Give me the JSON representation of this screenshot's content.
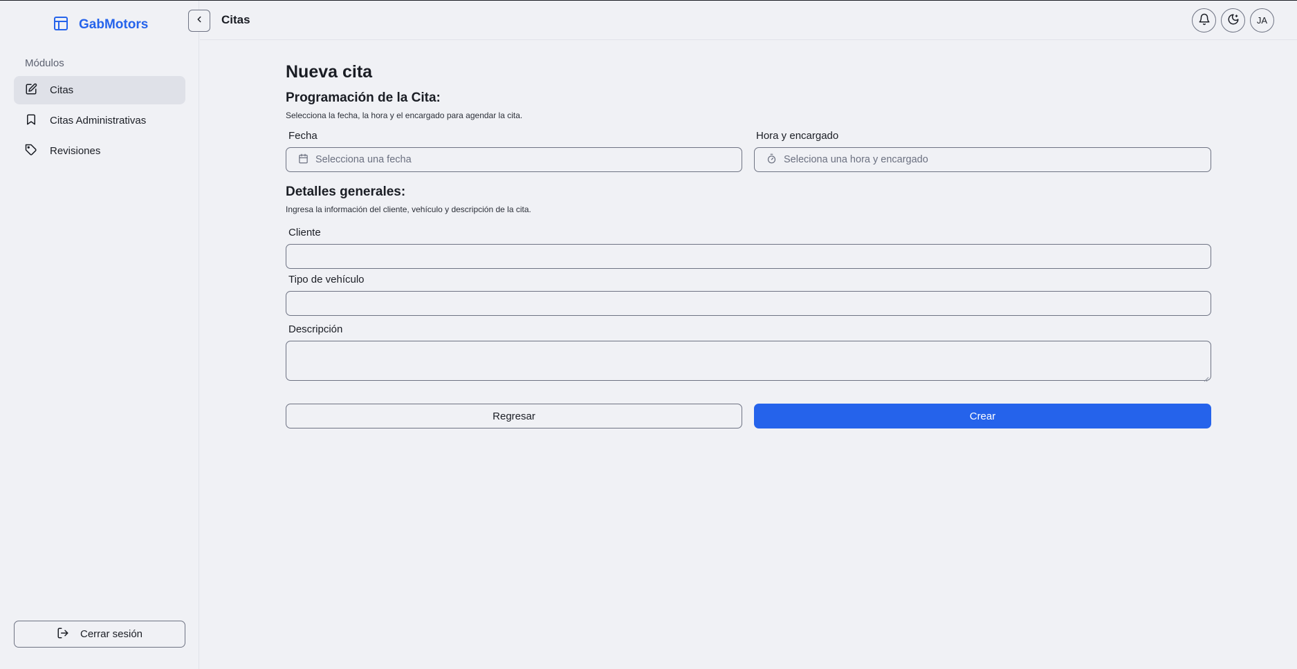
{
  "app": {
    "brand": "GabMotors",
    "brand_color": "#2563eb"
  },
  "sidebar": {
    "section_label": "Módulos",
    "items": [
      {
        "label": "Citas",
        "icon": "edit-icon",
        "active": true
      },
      {
        "label": "Citas Administrativas",
        "icon": "bookmark-icon",
        "active": false
      },
      {
        "label": "Revisiones",
        "icon": "tag-icon",
        "active": false
      }
    ],
    "logout_label": "Cerrar sesión"
  },
  "header": {
    "title": "Citas",
    "avatar_initials": "JA"
  },
  "form": {
    "title": "Nueva cita",
    "scheduling": {
      "title": "Programación de la Cita:",
      "description": "Selecciona la fecha, la hora y el encargado para agendar la cita.",
      "date_label": "Fecha",
      "date_placeholder": "Selecciona una fecha",
      "time_label": "Hora y encargado",
      "time_placeholder": "Seleciona una hora y encargado"
    },
    "details": {
      "title": "Detalles generales:",
      "description": "Ingresa la información del cliente, vehículo y descripción de la cita.",
      "client_label": "Cliente",
      "client_value": "",
      "vehicle_label": "Tipo de vehículo",
      "vehicle_value": "",
      "description_label": "Descripción",
      "description_value": ""
    },
    "back_label": "Regresar",
    "create_label": "Crear"
  }
}
